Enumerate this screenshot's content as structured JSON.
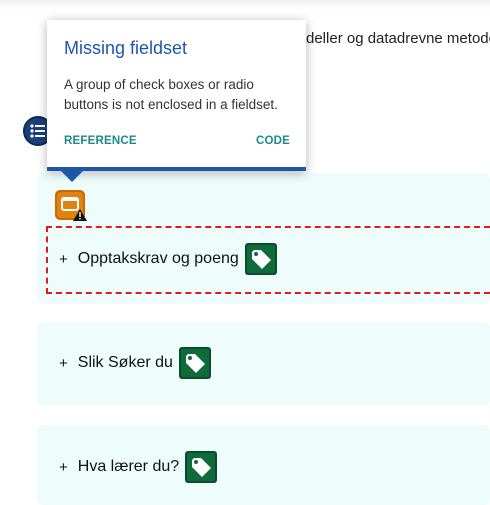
{
  "page": {
    "text_fragment": "deller og datadrevne metoder"
  },
  "popup": {
    "title": "Missing fieldset",
    "description": "A group of check boxes or radio buttons is not enclosed in a fieldset.",
    "reference_label": "REFERENCE",
    "code_label": "CODE"
  },
  "sections": [
    {
      "label": "Opptakskrav og poeng",
      "prefix": "+",
      "icon": "tag-icon"
    },
    {
      "label": "Slik Søker du",
      "prefix": "+",
      "icon": "tag-icon"
    },
    {
      "label": "Hva lærer du?",
      "prefix": "+",
      "icon": "tag-icon"
    }
  ],
  "icons": {
    "list": "list-icon",
    "fieldset_alert": "fieldset-alert-icon"
  },
  "colors": {
    "accent_blue": "#1f56a8",
    "link_teal": "#1a8a8a",
    "error_red": "#e01b1b",
    "tag_green": "#0f6b3a",
    "alert_orange": "#c96a06",
    "card_bg": "#eefcfc"
  }
}
